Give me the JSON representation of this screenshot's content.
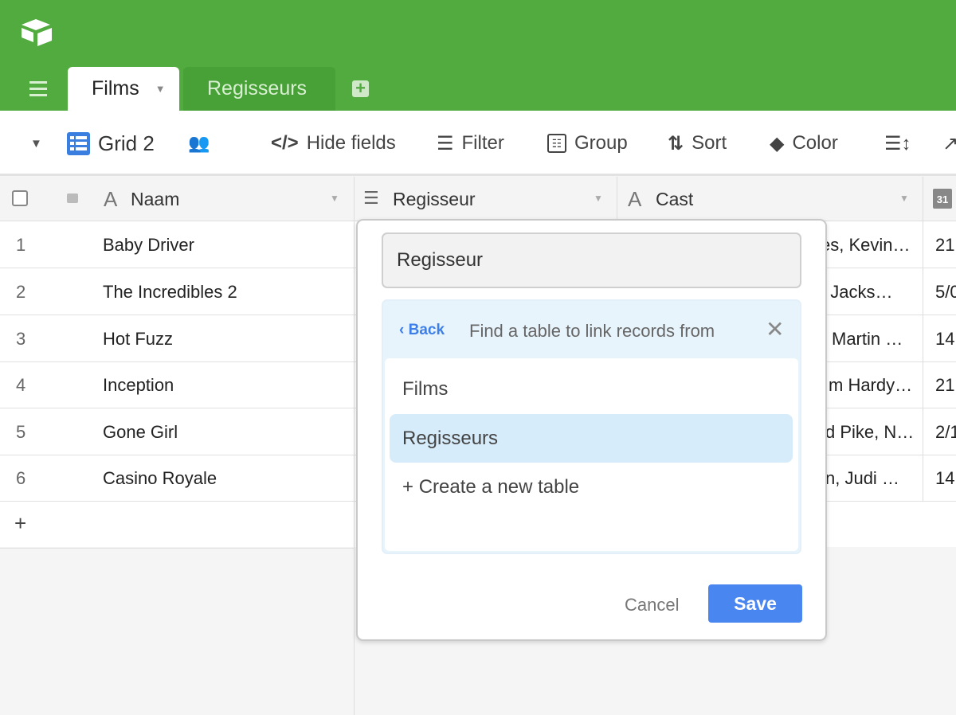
{
  "header": {
    "tabs": [
      {
        "label": "Films",
        "active": true
      },
      {
        "label": "Regisseurs",
        "active": false
      }
    ],
    "brand_color": "#52ab3e"
  },
  "toolbar": {
    "view_name": "Grid 2",
    "hide_fields": "Hide fields",
    "filter": "Filter",
    "group": "Group",
    "sort": "Sort",
    "color": "Color"
  },
  "grid": {
    "columns": [
      "Naam",
      "Regisseur",
      "Cast"
    ],
    "rows": [
      {
        "num": "1",
        "naam": "Baby Driver",
        "cast": "es, Kevin…",
        "date": "21"
      },
      {
        "num": "2",
        "naam": "The Incredibles 2",
        "cast": ". Jacks…",
        "date": "5/0"
      },
      {
        "num": "3",
        "naam": "Hot Fuzz",
        "cast": "Martin …",
        "date": "14"
      },
      {
        "num": "4",
        "naam": "Inception",
        "cast": "m Hardy…",
        "date": "21"
      },
      {
        "num": "5",
        "naam": "Gone Girl",
        "cast": "d Pike, N…",
        "date": "2/1"
      },
      {
        "num": "6",
        "naam": "Casino Royale",
        "cast": "n, Judi …",
        "date": "14"
      }
    ],
    "add_row": "+"
  },
  "popup": {
    "field_name": "Regisseur",
    "back": "Back",
    "prompt": "Find a table to link records from",
    "tables": [
      {
        "label": "Films",
        "selected": false
      },
      {
        "label": "Regisseurs",
        "selected": true
      }
    ],
    "create": "Create a new table",
    "cancel": "Cancel",
    "save": "Save",
    "accent": "#4a86f0"
  }
}
